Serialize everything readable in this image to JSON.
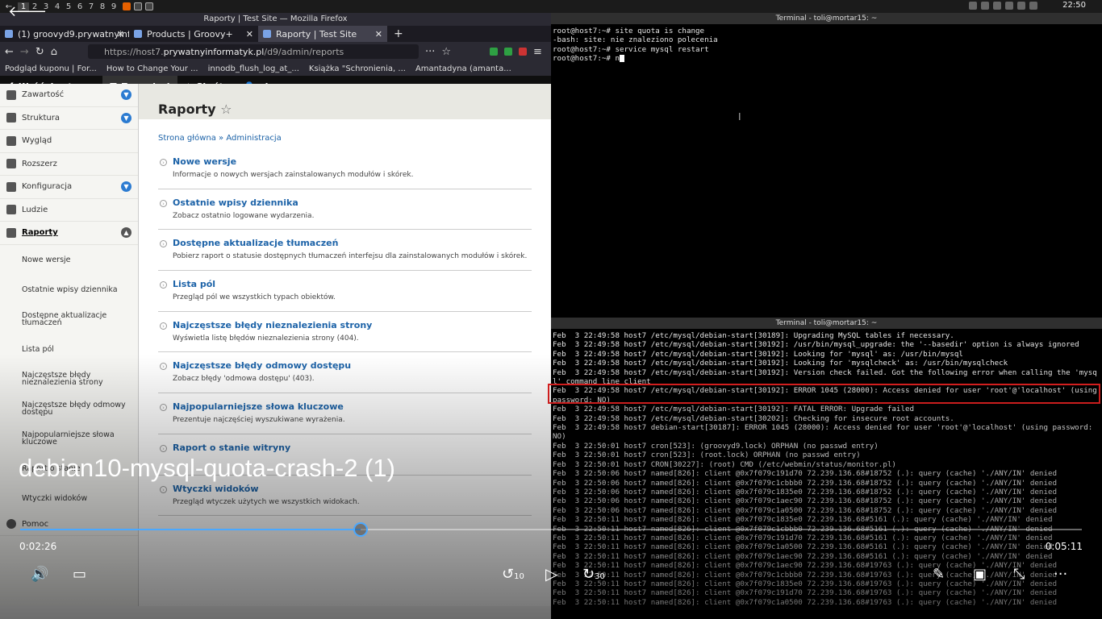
{
  "system": {
    "workspaces": [
      "1",
      "2",
      "3",
      "4",
      "5",
      "6",
      "7",
      "8",
      "9"
    ],
    "active_ws": "1",
    "clock": "22:50"
  },
  "firefox": {
    "window_title": "Raporty | Test Site — Mozilla Firefox",
    "tabs": [
      {
        "label": "(1) groovyd9.prywatnyinfor"
      },
      {
        "label": "Products | Groovy+"
      },
      {
        "label": "Raporty | Test Site"
      }
    ],
    "new_tab": "+",
    "url_prefix": "https://host7.",
    "url_domain": "prywatnyinformatyk.pl",
    "url_path": "/d9/admin/reports",
    "bookmarks": [
      "Podgląd kuponu | For...",
      "How to Change Your ...",
      "innodb_flush_log_at_...",
      "Książka \"Schronienia, ...",
      "Amantadyna (amanta..."
    ]
  },
  "drupal": {
    "toolbar": {
      "back": "Wróć do strony",
      "manage": "Zarządzaj",
      "shortcuts": "Skróty",
      "user": "gizmo"
    },
    "sidebar": [
      {
        "label": "Zawartość",
        "expand": true
      },
      {
        "label": "Struktura",
        "expand": true
      },
      {
        "label": "Wygląd",
        "expand": false
      },
      {
        "label": "Rozszerz",
        "expand": false
      },
      {
        "label": "Konfiguracja",
        "expand": true
      },
      {
        "label": "Ludzie",
        "expand": false
      },
      {
        "label": "Raporty",
        "expand": true
      }
    ],
    "subitems": [
      "Nowe wersje",
      "Ostatnie wpisy dziennika",
      "Dostępne aktualizacje tłumaczeń",
      "Lista pól",
      "Najczęstsze błędy nieznalezienia strony",
      "Najczęstsze błędy odmowy dostępu",
      "Najpopularniejsze słowa kluczowe",
      "Raport o stanie",
      "Wtyczki widoków"
    ],
    "help": "Pomoc",
    "page_title": "Raporty",
    "breadcrumb": "Strona główna » Administracja",
    "reports": [
      {
        "title": "Nowe wersje",
        "desc": "Informacje o nowych wersjach zainstalowanych modułów i skórek."
      },
      {
        "title": "Ostatnie wpisy dziennika",
        "desc": "Zobacz ostatnio logowane wydarzenia."
      },
      {
        "title": "Dostępne aktualizacje tłumaczeń",
        "desc": "Pobierz raport o statusie dostępnych tłumaczeń interfejsu dla zainstalowanych modułów i skórek."
      },
      {
        "title": "Lista pól",
        "desc": "Przegląd pól we wszystkich typach obiektów."
      },
      {
        "title": "Najczęstsze błędy nieznalezienia strony",
        "desc": "Wyświetla listę błędów nieznalezienia strony (404)."
      },
      {
        "title": "Najczęstsze błędy odmowy dostępu",
        "desc": "Zobacz błędy 'odmowa dostępu' (403)."
      },
      {
        "title": "Najpopularniejsze słowa kluczowe",
        "desc": "Prezentuje najczęściej wyszukiwane wyrażenia."
      },
      {
        "title": "Raport o stanie witryny",
        "desc": ""
      },
      {
        "title": "Wtyczki widoków",
        "desc": "Przegląd wtyczek użytych we wszystkich widokach."
      }
    ]
  },
  "terminal1": {
    "title": "Terminal - toli@mortar15: ~",
    "text": "root@host7:~# site quota is change\n-bash: site: nie znaleziono polecenia\nroot@host7:~# service mysql restart\nroot@host7:~# n"
  },
  "terminal2": {
    "title": "Terminal - toli@mortar15: ~",
    "text": "Feb  3 22:49:58 host7 /etc/mysql/debian-start[30189]: Upgrading MySQL tables if necessary.\nFeb  3 22:49:58 host7 /etc/mysql/debian-start[30192]: /usr/bin/mysql_upgrade: the '--basedir' option is always ignored\nFeb  3 22:49:58 host7 /etc/mysql/debian-start[30192]: Looking for 'mysql' as: /usr/bin/mysql\nFeb  3 22:49:58 host7 /etc/mysql/debian-start[30192]: Looking for 'mysqlcheck' as: /usr/bin/mysqlcheck\nFeb  3 22:49:58 host7 /etc/mysql/debian-start[30192]: Version check failed. Got the following error when calling the 'mysql' command line client\nFeb  3 22:49:58 host7 /etc/mysql/debian-start[30192]: ERROR 1045 (28000): Access denied for user 'root'@'localhost' (using password: NO)\nFeb  3 22:49:58 host7 /etc/mysql/debian-start[30192]: FATAL ERROR: Upgrade failed\nFeb  3 22:49:58 host7 /etc/mysql/debian-start[30202]: Checking for insecure root accounts.\nFeb  3 22:49:58 host7 debian-start[30187]: ERROR 1045 (28000): Access denied for user 'root'@'localhost' (using password: NO)\nFeb  3 22:50:01 host7 cron[523]: (groovyd9.lock) ORPHAN (no passwd entry)\nFeb  3 22:50:01 host7 cron[523]: (root.lock) ORPHAN (no passwd entry)\nFeb  3 22:50:01 host7 CRON[30227]: (root) CMD (/etc/webmin/status/monitor.pl)\nFeb  3 22:50:06 host7 named[826]: client @0x7f079c191d70 72.239.136.68#18752 (.): query (cache) './ANY/IN' denied\nFeb  3 22:50:06 host7 named[826]: client @0x7f079c1cbbb0 72.239.136.68#18752 (.): query (cache) './ANY/IN' denied\nFeb  3 22:50:06 host7 named[826]: client @0x7f079c1835e0 72.239.136.68#18752 (.): query (cache) './ANY/IN' denied\nFeb  3 22:50:06 host7 named[826]: client @0x7f079c1aec90 72.239.136.68#18752 (.): query (cache) './ANY/IN' denied\nFeb  3 22:50:06 host7 named[826]: client @0x7f079c1a0500 72.239.136.68#18752 (.): query (cache) './ANY/IN' denied\nFeb  3 22:50:11 host7 named[826]: client @0x7f079c1835e0 72.239.136.68#5161 (.): query (cache) './ANY/IN' denied\nFeb  3 22:50:11 host7 named[826]: client @0x7f079c1cbbb0 72.239.136.68#5161 (.): query (cache) './ANY/IN' denied\nFeb  3 22:50:11 host7 named[826]: client @0x7f079c191d70 72.239.136.68#5161 (.): query (cache) './ANY/IN' denied\nFeb  3 22:50:11 host7 named[826]: client @0x7f079c1a0500 72.239.136.68#5161 (.): query (cache) './ANY/IN' denied\nFeb  3 22:50:11 host7 named[826]: client @0x7f079c1aec90 72.239.136.68#5161 (.): query (cache) './ANY/IN' denied\nFeb  3 22:50:11 host7 named[826]: client @0x7f079c1aec90 72.239.136.68#19763 (.): query (cache) './ANY/IN' denied\nFeb  3 22:50:11 host7 named[826]: client @0x7f079c1cbbb0 72.239.136.68#19763 (.): query (cache) './ANY/IN' denied\nFeb  3 22:50:11 host7 named[826]: client @0x7f079c1835e0 72.239.136.68#19763 (.): query (cache) './ANY/IN' denied\nFeb  3 22:50:11 host7 named[826]: client @0x7f079c191d70 72.239.136.68#19763 (.): query (cache) './ANY/IN' denied\nFeb  3 22:50:11 host7 named[826]: client @0x7f079c1a0500 72.239.136.68#19763 (.): query (cache) './ANY/IN' denied"
  },
  "video": {
    "title": "debian10-mysql-quota-crash-2 (1)",
    "current": "0:02:26",
    "duration": "0:05:11",
    "progress": 0.321,
    "skip_back": "10",
    "skip_fwd": "30"
  }
}
